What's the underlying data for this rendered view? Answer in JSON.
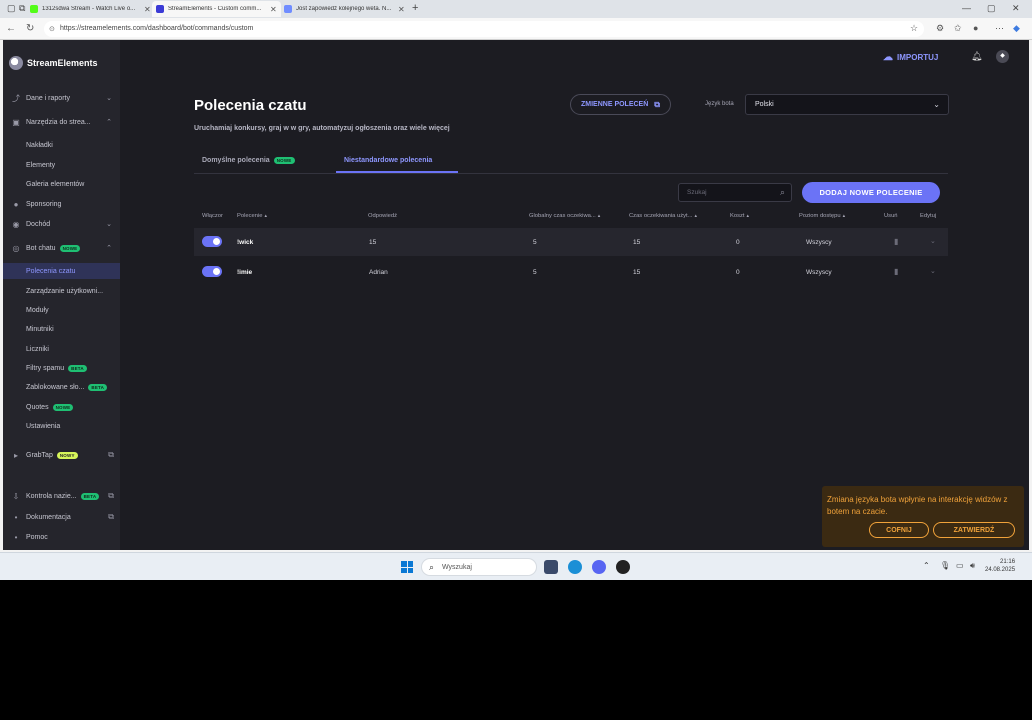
{
  "browser": {
    "tabs": [
      {
        "title": "1312sdwa Stream - Watch Live o...",
        "color": "#53fc18"
      },
      {
        "title": "StreamElements - Custom comm...",
        "color": "#3b3bd6"
      },
      {
        "title": "Jost zapowiedź kolejnego weta. N...",
        "color": "#6f8cff"
      }
    ],
    "url": "https://streamelements.com/dashboard/bot/commands/custom"
  },
  "sidebar": {
    "brand": "StreamElements",
    "items": [
      {
        "label": "Dane i raporty",
        "icon": "chart-icon",
        "glyph": "⤴",
        "chev": "⌄"
      },
      {
        "label": "Narzędzia do strea...",
        "icon": "tools-icon",
        "glyph": "▣",
        "chev": "⌃"
      },
      {
        "label": "Nakładki",
        "sub": true
      },
      {
        "label": "Elementy",
        "sub": true
      },
      {
        "label": "Galeria elementów",
        "sub": true
      },
      {
        "label": "Sponsoring",
        "icon": "sponsor-icon",
        "glyph": "●"
      },
      {
        "label": "Dochód",
        "icon": "revenue-icon",
        "glyph": "◉",
        "chev": "⌄"
      },
      {
        "label": "Bot chatu",
        "icon": "bot-icon",
        "glyph": "◎",
        "badge": "NOWE",
        "chev": "⌃"
      },
      {
        "label": "Polecenia czatu",
        "sub": true,
        "active": true
      },
      {
        "label": "Zarządzanie użytkowni...",
        "sub": true
      },
      {
        "label": "Moduły",
        "sub": true
      },
      {
        "label": "Minutniki",
        "sub": true
      },
      {
        "label": "Liczniki",
        "sub": true
      },
      {
        "label": "Filtry spamu",
        "sub": true,
        "badge": "BETA"
      },
      {
        "label": "Zablokowane sło...",
        "sub": true,
        "badge": "BETA"
      },
      {
        "label": "Quotes",
        "sub": true,
        "badge": "NOWE"
      },
      {
        "label": "Ustawienia",
        "sub": true
      },
      {
        "label": "GrabTap",
        "icon": "grabtap-icon",
        "glyph": "▸",
        "badge": "NOWY",
        "yellow": true,
        "ext": true
      },
      {
        "label": "Kontrola nazie...",
        "icon": "download-icon",
        "glyph": "⇩",
        "badge": "BETA",
        "ext": true
      },
      {
        "label": "Dokumentacja",
        "icon": "doc-icon",
        "glyph": "",
        "ext": true
      },
      {
        "label": "Pomoc",
        "icon": "help-icon",
        "glyph": ""
      }
    ]
  },
  "header": {
    "import_label": "IMPORTUJ"
  },
  "page": {
    "title": "Polecenia czatu",
    "subtitle": "Uruchamiaj konkursy, graj w w gry, automatyzuj ogłoszenia oraz wiele więcej",
    "vars_button": "ZMIENNE POLECEŃ",
    "lang_label": "Język bota",
    "lang_value": "Polski",
    "tab_default": "Domyślne polecenia",
    "tab_default_badge": "NOWE",
    "tab_custom": "Niestandardowe polecenia",
    "search_placeholder": "Szukaj",
    "add_button": "DODAJ NOWE POLECENIE"
  },
  "table": {
    "headers": {
      "enabled": "Włączor",
      "command": "Polecenie",
      "response": "Odpowiedź",
      "global_cd": "Globalny czas oczekiwa...",
      "user_cd": "Czas oczekiwania użyt...",
      "cost": "Koszt",
      "access": "Poziom dostępu",
      "delete": "Usuń",
      "edit": "Edytuj"
    },
    "rows": [
      {
        "command": "!wick",
        "response": "15",
        "global_cd": "5",
        "user_cd": "15",
        "cost": "0",
        "access": "Wszyscy"
      },
      {
        "command": "!imie",
        "response": "Adrian",
        "global_cd": "5",
        "user_cd": "15",
        "cost": "0",
        "access": "Wszyscy"
      }
    ]
  },
  "toast": {
    "message": "Zmiana języka bota wpłynie na interakcję widzów z botem na czacie.",
    "undo": "COFNIJ",
    "confirm": "ZATWIERDŹ"
  },
  "taskbar": {
    "search": "Wyszukaj",
    "time": "21:16",
    "date": "24.08.2025"
  }
}
